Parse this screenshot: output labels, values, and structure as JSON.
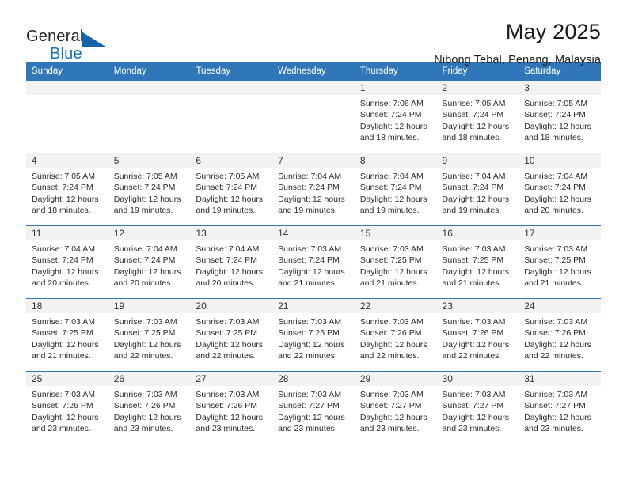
{
  "brand": {
    "name_part1": "General",
    "name_part2": "Blue",
    "logo_icon": "blue-triangle-logo"
  },
  "header": {
    "title": "May 2025",
    "subtitle": "Nibong Tebal, Penang, Malaysia"
  },
  "calendar": {
    "weekday_headers": [
      "Sunday",
      "Monday",
      "Tuesday",
      "Wednesday",
      "Thursday",
      "Friday",
      "Saturday"
    ],
    "accent_color": "#2f77b8",
    "daynum_band_color": "#f2f2f2",
    "weeks": [
      [
        {
          "day": "",
          "sunrise": "",
          "sunset": "",
          "daylight_line1": "",
          "daylight_line2": ""
        },
        {
          "day": "",
          "sunrise": "",
          "sunset": "",
          "daylight_line1": "",
          "daylight_line2": ""
        },
        {
          "day": "",
          "sunrise": "",
          "sunset": "",
          "daylight_line1": "",
          "daylight_line2": ""
        },
        {
          "day": "",
          "sunrise": "",
          "sunset": "",
          "daylight_line1": "",
          "daylight_line2": ""
        },
        {
          "day": "1",
          "sunrise": "Sunrise: 7:06 AM",
          "sunset": "Sunset: 7:24 PM",
          "daylight_line1": "Daylight: 12 hours",
          "daylight_line2": "and 18 minutes."
        },
        {
          "day": "2",
          "sunrise": "Sunrise: 7:05 AM",
          "sunset": "Sunset: 7:24 PM",
          "daylight_line1": "Daylight: 12 hours",
          "daylight_line2": "and 18 minutes."
        },
        {
          "day": "3",
          "sunrise": "Sunrise: 7:05 AM",
          "sunset": "Sunset: 7:24 PM",
          "daylight_line1": "Daylight: 12 hours",
          "daylight_line2": "and 18 minutes."
        }
      ],
      [
        {
          "day": "4",
          "sunrise": "Sunrise: 7:05 AM",
          "sunset": "Sunset: 7:24 PM",
          "daylight_line1": "Daylight: 12 hours",
          "daylight_line2": "and 18 minutes."
        },
        {
          "day": "5",
          "sunrise": "Sunrise: 7:05 AM",
          "sunset": "Sunset: 7:24 PM",
          "daylight_line1": "Daylight: 12 hours",
          "daylight_line2": "and 19 minutes."
        },
        {
          "day": "6",
          "sunrise": "Sunrise: 7:05 AM",
          "sunset": "Sunset: 7:24 PM",
          "daylight_line1": "Daylight: 12 hours",
          "daylight_line2": "and 19 minutes."
        },
        {
          "day": "7",
          "sunrise": "Sunrise: 7:04 AM",
          "sunset": "Sunset: 7:24 PM",
          "daylight_line1": "Daylight: 12 hours",
          "daylight_line2": "and 19 minutes."
        },
        {
          "day": "8",
          "sunrise": "Sunrise: 7:04 AM",
          "sunset": "Sunset: 7:24 PM",
          "daylight_line1": "Daylight: 12 hours",
          "daylight_line2": "and 19 minutes."
        },
        {
          "day": "9",
          "sunrise": "Sunrise: 7:04 AM",
          "sunset": "Sunset: 7:24 PM",
          "daylight_line1": "Daylight: 12 hours",
          "daylight_line2": "and 19 minutes."
        },
        {
          "day": "10",
          "sunrise": "Sunrise: 7:04 AM",
          "sunset": "Sunset: 7:24 PM",
          "daylight_line1": "Daylight: 12 hours",
          "daylight_line2": "and 20 minutes."
        }
      ],
      [
        {
          "day": "11",
          "sunrise": "Sunrise: 7:04 AM",
          "sunset": "Sunset: 7:24 PM",
          "daylight_line1": "Daylight: 12 hours",
          "daylight_line2": "and 20 minutes."
        },
        {
          "day": "12",
          "sunrise": "Sunrise: 7:04 AM",
          "sunset": "Sunset: 7:24 PM",
          "daylight_line1": "Daylight: 12 hours",
          "daylight_line2": "and 20 minutes."
        },
        {
          "day": "13",
          "sunrise": "Sunrise: 7:04 AM",
          "sunset": "Sunset: 7:24 PM",
          "daylight_line1": "Daylight: 12 hours",
          "daylight_line2": "and 20 minutes."
        },
        {
          "day": "14",
          "sunrise": "Sunrise: 7:03 AM",
          "sunset": "Sunset: 7:24 PM",
          "daylight_line1": "Daylight: 12 hours",
          "daylight_line2": "and 21 minutes."
        },
        {
          "day": "15",
          "sunrise": "Sunrise: 7:03 AM",
          "sunset": "Sunset: 7:25 PM",
          "daylight_line1": "Daylight: 12 hours",
          "daylight_line2": "and 21 minutes."
        },
        {
          "day": "16",
          "sunrise": "Sunrise: 7:03 AM",
          "sunset": "Sunset: 7:25 PM",
          "daylight_line1": "Daylight: 12 hours",
          "daylight_line2": "and 21 minutes."
        },
        {
          "day": "17",
          "sunrise": "Sunrise: 7:03 AM",
          "sunset": "Sunset: 7:25 PM",
          "daylight_line1": "Daylight: 12 hours",
          "daylight_line2": "and 21 minutes."
        }
      ],
      [
        {
          "day": "18",
          "sunrise": "Sunrise: 7:03 AM",
          "sunset": "Sunset: 7:25 PM",
          "daylight_line1": "Daylight: 12 hours",
          "daylight_line2": "and 21 minutes."
        },
        {
          "day": "19",
          "sunrise": "Sunrise: 7:03 AM",
          "sunset": "Sunset: 7:25 PM",
          "daylight_line1": "Daylight: 12 hours",
          "daylight_line2": "and 22 minutes."
        },
        {
          "day": "20",
          "sunrise": "Sunrise: 7:03 AM",
          "sunset": "Sunset: 7:25 PM",
          "daylight_line1": "Daylight: 12 hours",
          "daylight_line2": "and 22 minutes."
        },
        {
          "day": "21",
          "sunrise": "Sunrise: 7:03 AM",
          "sunset": "Sunset: 7:25 PM",
          "daylight_line1": "Daylight: 12 hours",
          "daylight_line2": "and 22 minutes."
        },
        {
          "day": "22",
          "sunrise": "Sunrise: 7:03 AM",
          "sunset": "Sunset: 7:26 PM",
          "daylight_line1": "Daylight: 12 hours",
          "daylight_line2": "and 22 minutes."
        },
        {
          "day": "23",
          "sunrise": "Sunrise: 7:03 AM",
          "sunset": "Sunset: 7:26 PM",
          "daylight_line1": "Daylight: 12 hours",
          "daylight_line2": "and 22 minutes."
        },
        {
          "day": "24",
          "sunrise": "Sunrise: 7:03 AM",
          "sunset": "Sunset: 7:26 PM",
          "daylight_line1": "Daylight: 12 hours",
          "daylight_line2": "and 22 minutes."
        }
      ],
      [
        {
          "day": "25",
          "sunrise": "Sunrise: 7:03 AM",
          "sunset": "Sunset: 7:26 PM",
          "daylight_line1": "Daylight: 12 hours",
          "daylight_line2": "and 23 minutes."
        },
        {
          "day": "26",
          "sunrise": "Sunrise: 7:03 AM",
          "sunset": "Sunset: 7:26 PM",
          "daylight_line1": "Daylight: 12 hours",
          "daylight_line2": "and 23 minutes."
        },
        {
          "day": "27",
          "sunrise": "Sunrise: 7:03 AM",
          "sunset": "Sunset: 7:26 PM",
          "daylight_line1": "Daylight: 12 hours",
          "daylight_line2": "and 23 minutes."
        },
        {
          "day": "28",
          "sunrise": "Sunrise: 7:03 AM",
          "sunset": "Sunset: 7:27 PM",
          "daylight_line1": "Daylight: 12 hours",
          "daylight_line2": "and 23 minutes."
        },
        {
          "day": "29",
          "sunrise": "Sunrise: 7:03 AM",
          "sunset": "Sunset: 7:27 PM",
          "daylight_line1": "Daylight: 12 hours",
          "daylight_line2": "and 23 minutes."
        },
        {
          "day": "30",
          "sunrise": "Sunrise: 7:03 AM",
          "sunset": "Sunset: 7:27 PM",
          "daylight_line1": "Daylight: 12 hours",
          "daylight_line2": "and 23 minutes."
        },
        {
          "day": "31",
          "sunrise": "Sunrise: 7:03 AM",
          "sunset": "Sunset: 7:27 PM",
          "daylight_line1": "Daylight: 12 hours",
          "daylight_line2": "and 23 minutes."
        }
      ]
    ]
  }
}
